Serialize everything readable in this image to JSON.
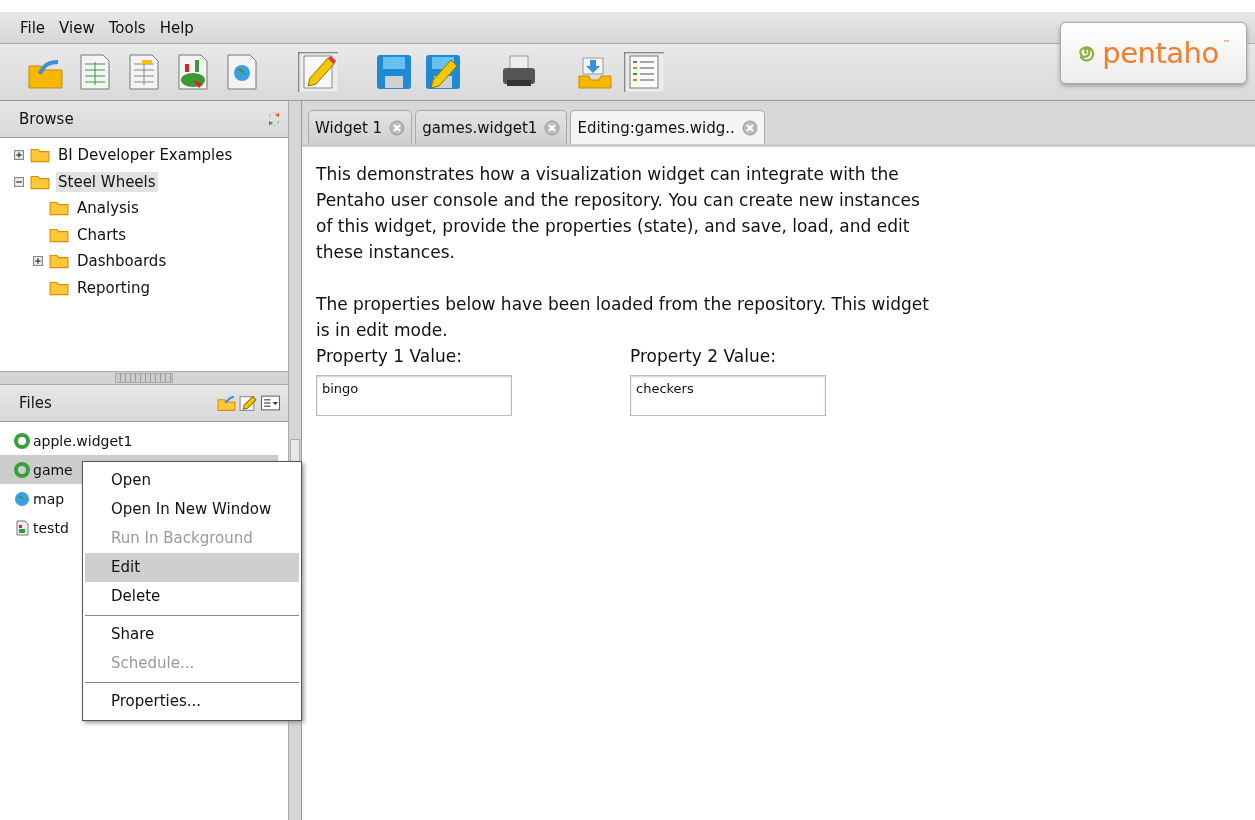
{
  "menu_bar": [
    "File",
    "View",
    "Tools",
    "Help"
  ],
  "logo": {
    "text": "pentaho",
    "mark": "™"
  },
  "browse": {
    "title": "Browse",
    "tree": [
      {
        "label": "BI Developer Examples",
        "expanded": false,
        "selected": false
      },
      {
        "label": "Steel Wheels",
        "expanded": true,
        "selected": true,
        "children": [
          {
            "label": "Analysis",
            "selected": false
          },
          {
            "label": "Charts",
            "selected": false
          },
          {
            "label": "Dashboards",
            "expanded": false,
            "selected": false
          },
          {
            "label": "Reporting",
            "selected": false
          }
        ]
      }
    ]
  },
  "files": {
    "title": "Files",
    "items": [
      {
        "label": "apple.widget1",
        "kind": "widget",
        "selected": false
      },
      {
        "label": "game",
        "kind": "widget",
        "selected": true
      },
      {
        "label": "map",
        "kind": "map",
        "selected": false
      },
      {
        "label": "testd",
        "kind": "report",
        "selected": false
      }
    ]
  },
  "context_menu": {
    "groups": [
      [
        {
          "label": "Open",
          "disabled": false,
          "selected": false
        },
        {
          "label": "Open In New Window",
          "disabled": false,
          "selected": false
        },
        {
          "label": "Run In Background",
          "disabled": true,
          "selected": false
        },
        {
          "label": "Edit",
          "disabled": false,
          "selected": true
        },
        {
          "label": "Delete",
          "disabled": false,
          "selected": false
        }
      ],
      [
        {
          "label": "Share",
          "disabled": false,
          "selected": false
        },
        {
          "label": "Schedule...",
          "disabled": true,
          "selected": false
        }
      ],
      [
        {
          "label": "Properties...",
          "disabled": false,
          "selected": false
        }
      ]
    ]
  },
  "tabs": [
    {
      "label": "Widget 1",
      "selected": false
    },
    {
      "label": "games.widget1",
      "selected": false
    },
    {
      "label": "Editing:games.widg..",
      "selected": true
    }
  ],
  "content": {
    "paragraphs": [
      "This demonstrates how a visualization widget can integrate with the Pentaho user console and the repository. You can create new instances of this widget, provide the properties (state), and save, load, and edit these instances.",
      "The properties below have been loaded from the repository. This widget is in edit mode."
    ],
    "properties": [
      {
        "label": "Property 1 Value:",
        "value": "bingo"
      },
      {
        "label": "Property 2 Value:",
        "value": "checkers"
      }
    ]
  }
}
